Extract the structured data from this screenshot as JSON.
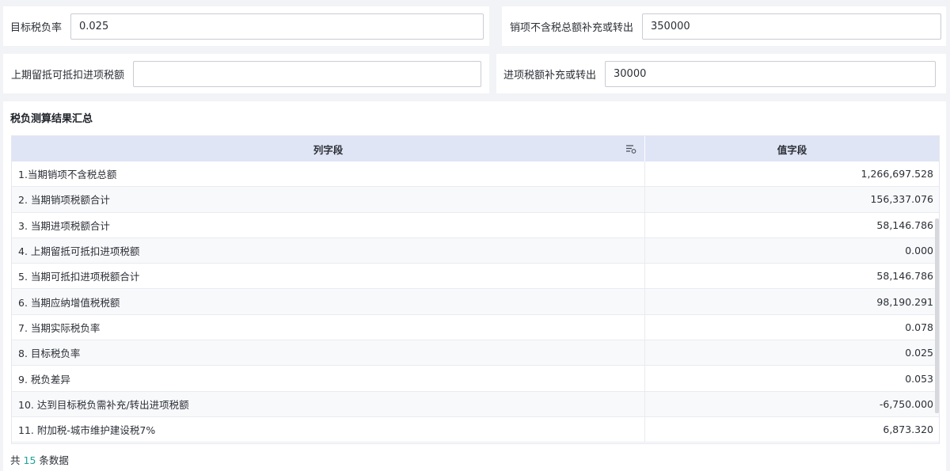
{
  "fields": {
    "target_rate": {
      "label": "目标税负率",
      "value": "0.025"
    },
    "output_adjust": {
      "label": "销项不含税总额补充或转出",
      "value": "350000"
    },
    "prior_credit": {
      "label": "上期留抵可抵扣进项税额",
      "value": ""
    },
    "input_adjust": {
      "label": "进项税额补充或转出",
      "value": "30000"
    }
  },
  "summary": {
    "title": "税负测算结果汇总",
    "columns": [
      "列字段",
      "值字段"
    ],
    "rows": [
      {
        "name": "1.当期销项不含税总额",
        "value": "1,266,697.528"
      },
      {
        "name": "2. 当期销项税额合计",
        "value": "156,337.076"
      },
      {
        "name": "3. 当期进项税额合计",
        "value": "58,146.786"
      },
      {
        "name": "4. 上期留抵可抵扣进项税额",
        "value": "0.000"
      },
      {
        "name": "5. 当期可抵扣进项税额合计",
        "value": "58,146.786"
      },
      {
        "name": "6. 当期应纳增值税税额",
        "value": "98,190.291"
      },
      {
        "name": "7. 当期实际税负率",
        "value": "0.078"
      },
      {
        "name": "8. 目标税负率",
        "value": "0.025"
      },
      {
        "name": "9. 税负差异",
        "value": "0.053"
      },
      {
        "name": "10. 达到目标税负需补充/转出进项税额",
        "value": "-6,750.000"
      },
      {
        "name": "11. 附加税-城市维护建设税7%",
        "value": "6,873.320"
      }
    ],
    "footer": {
      "prefix": "共",
      "count": "15",
      "suffix": "条数据"
    }
  }
}
